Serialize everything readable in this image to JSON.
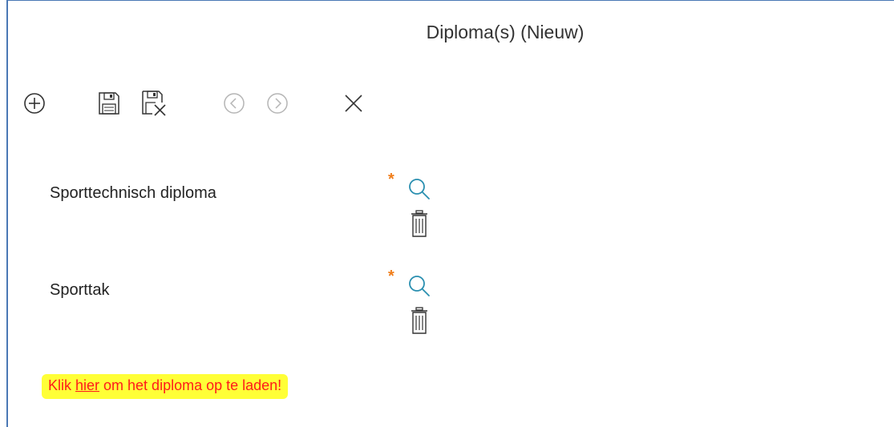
{
  "window": {
    "title": "Diploma(s) (Nieuw)"
  },
  "toolbar": {
    "buttons": [
      {
        "name": "add",
        "icon": "plus-circle-icon"
      },
      {
        "name": "save",
        "icon": "floppy-disk-icon"
      },
      {
        "name": "save-close",
        "icon": "floppy-disk-x-icon"
      },
      {
        "name": "previous",
        "icon": "chevron-left-circle-icon"
      },
      {
        "name": "next",
        "icon": "chevron-right-circle-icon"
      },
      {
        "name": "close",
        "icon": "close-icon"
      }
    ]
  },
  "form": {
    "fields": [
      {
        "label": "Sporttechnisch diploma",
        "required_marker": "*",
        "required": true
      },
      {
        "label": "Sporttak",
        "required_marker": "*",
        "required": true
      }
    ]
  },
  "upload": {
    "prefix": "Klik ",
    "link_text": "hier",
    "suffix": " om het diploma op te laden!"
  },
  "colors": {
    "frame_border": "#4a78b5",
    "required": "#f07d1a",
    "search_icon": "#2a8fb0",
    "highlight": "#ffff37",
    "upload_text": "#ff1a1a"
  }
}
